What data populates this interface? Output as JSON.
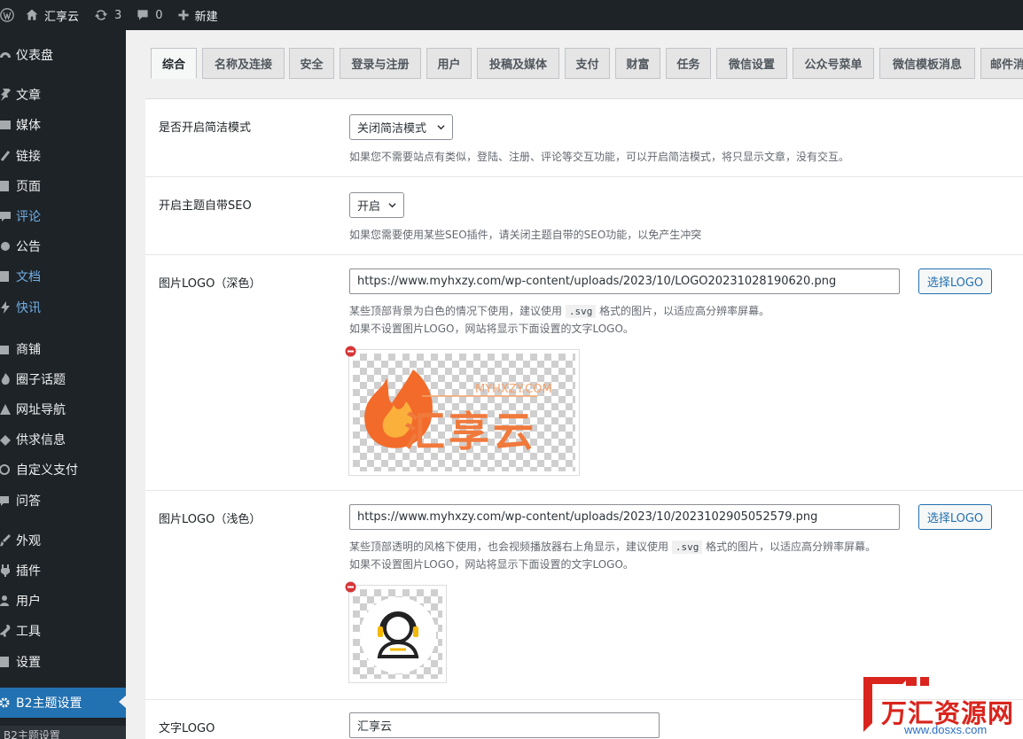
{
  "adminbar": {
    "site_name": "汇享云",
    "updates_count": "3",
    "comments_count": "0",
    "new_label": "新建"
  },
  "sidebar": {
    "items": [
      {
        "label": "仪表盘",
        "icon": "dashboard-icon"
      },
      {
        "label": "文章",
        "icon": "pushpin-icon"
      },
      {
        "label": "媒体",
        "icon": "media-icon"
      },
      {
        "label": "链接",
        "icon": "link-icon"
      },
      {
        "label": "页面",
        "icon": "page-icon"
      },
      {
        "label": "评论",
        "icon": "comment-icon"
      },
      {
        "label": "公告",
        "icon": "megaphone-icon"
      },
      {
        "label": "文档",
        "icon": "document-icon"
      },
      {
        "label": "快讯",
        "icon": "flash-icon"
      },
      {
        "label": "商铺",
        "icon": "store-icon"
      },
      {
        "label": "圈子话题",
        "icon": "circle-icon"
      },
      {
        "label": "网址导航",
        "icon": "nav-icon"
      },
      {
        "label": "供求信息",
        "icon": "trade-icon"
      },
      {
        "label": "自定义支付",
        "icon": "pay-icon"
      },
      {
        "label": "问答",
        "icon": "qa-icon"
      },
      {
        "label": "外观",
        "icon": "brush-icon"
      },
      {
        "label": "插件",
        "icon": "plugin-icon"
      },
      {
        "label": "用户",
        "icon": "user-icon"
      },
      {
        "label": "工具",
        "icon": "wrench-icon"
      },
      {
        "label": "设置",
        "icon": "settings-icon"
      },
      {
        "label": "B2主题设置",
        "icon": "gear-icon"
      }
    ],
    "submenu_peek": "B2主题设置"
  },
  "tabs": [
    "综合",
    "名称及连接",
    "安全",
    "登录与注册",
    "用户",
    "投稿及媒体",
    "支付",
    "财富",
    "任务",
    "微信设置",
    "公众号菜单",
    "微信模板消息",
    "邮件消"
  ],
  "settings": {
    "simple_mode": {
      "label": "是否开启简洁模式",
      "value": "关闭简洁模式",
      "desc": "如果您不需要站点有类似，登陆、注册、评论等交互功能，可以开启简洁模式，将只显示文章，没有交互。"
    },
    "seo": {
      "label": "开启主题自带SEO",
      "value": "开启",
      "desc": "如果您需要使用某些SEO插件，请关闭主题自带的SEO功能，以免产生冲突"
    },
    "logo_dark": {
      "label": "图片LOGO（深色）",
      "value": "https://www.myhxzy.com/wp-content/uploads/2023/10/LOGO20231028190620.png",
      "button": "选择LOGO",
      "desc_before": "某些顶部背景为白色的情况下使用，建议使用",
      "desc_code": ".svg",
      "desc_after": "格式的图片，以适应高分辨率屏幕。",
      "desc2": "如果不设置图片LOGO，网站将显示下面设置的文字LOGO。",
      "logo_main": "汇享云",
      "logo_sub": "MYHXZY.COM"
    },
    "logo_light": {
      "label": "图片LOGO（浅色）",
      "value": "https://www.myhxzy.com/wp-content/uploads/2023/10/2023102905052579.png",
      "button": "选择LOGO",
      "desc_before": "某些顶部透明的风格下使用，也会视频播放器右上角显示，建议使用",
      "desc_code": ".svg",
      "desc_after": "格式的图片，以适应高分辨率屏幕。",
      "desc2": "如果不设置图片LOGO，网站将显示下面设置的文字LOGO。"
    },
    "text_logo": {
      "label": "文字LOGO",
      "value": "汇享云"
    }
  },
  "watermark": {
    "name": "万汇资源网",
    "url": "www.dosxs.com"
  },
  "colors": {
    "adminbar_bg": "#1d2327",
    "accent": "#2271b1",
    "link": "#72aee6",
    "logo_orange": "#f26b2a",
    "watermark_red": "#d9251d"
  }
}
